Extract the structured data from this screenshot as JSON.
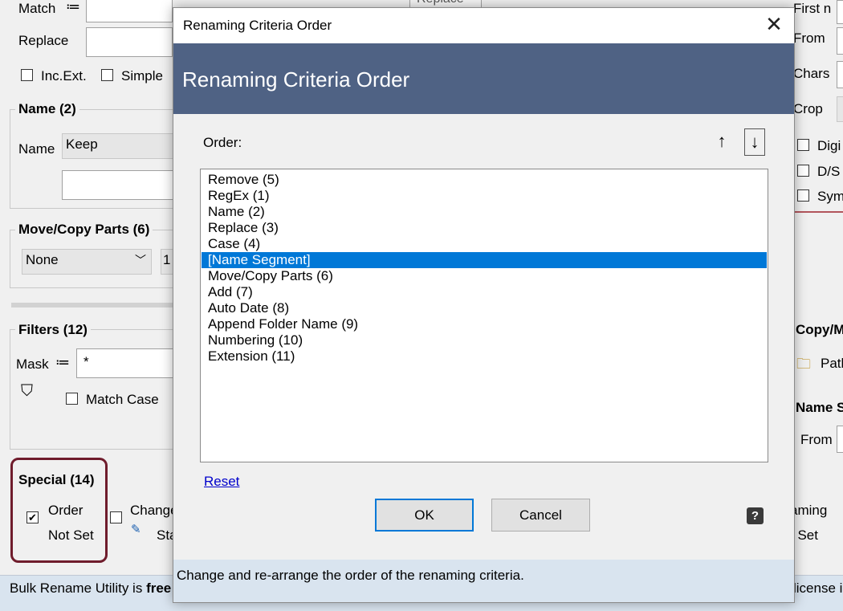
{
  "background": {
    "rename_group": {
      "match_label": "Match",
      "replace_label": "Replace",
      "incext_label": "Inc.Ext.",
      "simple_label": "Simple"
    },
    "name_group": {
      "title": "Name (2)",
      "name_label": "Name",
      "name_value": "Keep"
    },
    "move_group": {
      "title": "Move/Copy Parts (6)",
      "select_value": "None",
      "second_value": "1"
    },
    "filters_group": {
      "title": "Filters (12)",
      "mask_label": "Mask",
      "mask_value": "*",
      "match_case_label": "Match Case"
    },
    "special_group": {
      "title": "Special (14)",
      "order_label": "Order",
      "not_set_label": "Not Set",
      "change_label": "Change",
      "sta_label": "Sta"
    },
    "right_column": {
      "first_n_label": "First n",
      "from_label": "From",
      "chars_label": "Chars",
      "crop_label": "Crop",
      "digi_label": "Digi",
      "ds_label": "D/S",
      "sym_label": "Sym",
      "copy_label": "Copy/M",
      "path_label": "Path",
      "name_s_label": "Name S",
      "from2_label": "From",
      "aming_label": "aming",
      "tset_label": "t Set"
    },
    "replace_tab_label": "Replace",
    "status_left_prefix": "Bulk Rename Utility is ",
    "status_left_bold": "free",
    "status_right": "license i"
  },
  "dialog": {
    "title": "Renaming Criteria Order",
    "banner": "Renaming Criteria Order",
    "order_label": "Order:",
    "up_arrow": "↑",
    "down_arrow": "↓",
    "items": [
      "Remove (5)",
      "RegEx (1)",
      "Name (2)",
      "Replace (3)",
      "Case (4)",
      "[Name Segment]",
      "Move/Copy Parts (6)",
      "Add (7)",
      "Auto Date (8)",
      "Append Folder Name (9)",
      "Numbering (10)",
      "Extension (11)"
    ],
    "selected_index": 5,
    "reset_label": "Reset",
    "ok_label": "OK",
    "cancel_label": "Cancel",
    "help_symbol": "?",
    "status_text": "Change and re-arrange the order of the renaming criteria.",
    "close_symbol": "✕"
  },
  "colors": {
    "banner": "#4f6284",
    "selection": "#0078d7",
    "highlight_box": "#6f1c2c",
    "status_bg": "#d9e4ef"
  }
}
